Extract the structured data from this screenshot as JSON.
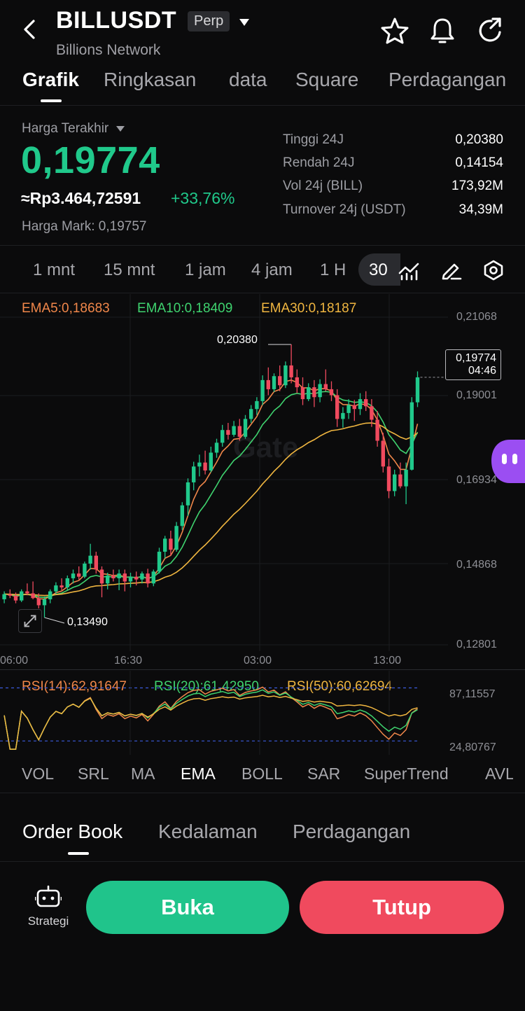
{
  "header": {
    "title": "BILLUSDT",
    "badge": "Perp",
    "subtitle": "Billions Network"
  },
  "tabs": [
    {
      "label": "Grafik",
      "active": true
    },
    {
      "label": "Ringkasan"
    },
    {
      "label": "data"
    },
    {
      "label": "Square"
    },
    {
      "label": "Perdagangan"
    }
  ],
  "price": {
    "last_label": "Harga Terakhir",
    "last": "0,19774",
    "idr": "≈Rp3.464,72591",
    "change": "+33,76%",
    "mark": "Harga Mark: 0,19757"
  },
  "stats": [
    {
      "label": "Tinggi 24J",
      "value": "0,20380"
    },
    {
      "label": "Rendah 24J",
      "value": "0,14154"
    },
    {
      "label": "Vol 24j (BILL)",
      "value": "173,92M"
    },
    {
      "label": "Turnover 24j (USDT)",
      "value": "34,39M"
    }
  ],
  "timeframes": [
    "1 mnt",
    "15 mnt",
    "1 jam",
    "4 jam",
    "1 H",
    "30"
  ],
  "active_timeframe": "30",
  "ema_labels": {
    "ema5": "EMA5:0,18683",
    "ema10": "EMA10:0,18409",
    "ema30": "EMA30:0,18187"
  },
  "chart_data": {
    "type": "candlestick",
    "y_ticks": [
      "0,21068",
      "0,19001",
      "0,16934",
      "0,14868",
      "0,12801"
    ],
    "x_ticks": [
      "06:00",
      "16:30",
      "03:00",
      "13:00"
    ],
    "high_label": "0,20380",
    "low_label": "0,13490",
    "last_price": "0,19774",
    "countdown": "04:46",
    "ylim": [
      0.12801,
      0.21068
    ],
    "candles": [
      [
        0.1395,
        0.1415,
        0.1385,
        0.1408
      ],
      [
        0.1408,
        0.142,
        0.1398,
        0.1404
      ],
      [
        0.1404,
        0.1412,
        0.1385,
        0.1392
      ],
      [
        0.1392,
        0.142,
        0.1388,
        0.1415
      ],
      [
        0.1415,
        0.1435,
        0.1405,
        0.141
      ],
      [
        0.141,
        0.144,
        0.1395,
        0.1398
      ],
      [
        0.1398,
        0.141,
        0.1372,
        0.138
      ],
      [
        0.138,
        0.1402,
        0.1349,
        0.1395
      ],
      [
        0.1395,
        0.142,
        0.1385,
        0.1415
      ],
      [
        0.1415,
        0.1438,
        0.1408,
        0.143
      ],
      [
        0.143,
        0.1448,
        0.1418,
        0.1425
      ],
      [
        0.1425,
        0.1455,
        0.1418,
        0.1448
      ],
      [
        0.1448,
        0.147,
        0.1435,
        0.146
      ],
      [
        0.146,
        0.1478,
        0.1445,
        0.1452
      ],
      [
        0.1452,
        0.149,
        0.1448,
        0.1485
      ],
      [
        0.1485,
        0.1535,
        0.147,
        0.1505
      ],
      [
        0.1505,
        0.1515,
        0.146,
        0.147
      ],
      [
        0.147,
        0.1478,
        0.14,
        0.1435
      ],
      [
        0.1435,
        0.1462,
        0.142,
        0.1455
      ],
      [
        0.1455,
        0.147,
        0.144,
        0.1448
      ],
      [
        0.1448,
        0.147,
        0.1418,
        0.146
      ],
      [
        0.146,
        0.147,
        0.1415,
        0.144
      ],
      [
        0.144,
        0.1462,
        0.1425,
        0.1452
      ],
      [
        0.1452,
        0.1465,
        0.143,
        0.1445
      ],
      [
        0.1445,
        0.1465,
        0.1435,
        0.146
      ],
      [
        0.146,
        0.1472,
        0.1425,
        0.1435
      ],
      [
        0.1435,
        0.147,
        0.1428,
        0.1465
      ],
      [
        0.1465,
        0.1525,
        0.146,
        0.1515
      ],
      [
        0.1515,
        0.1555,
        0.1498,
        0.1548
      ],
      [
        0.1548,
        0.1568,
        0.1505,
        0.152
      ],
      [
        0.152,
        0.159,
        0.1515,
        0.158
      ],
      [
        0.158,
        0.164,
        0.157,
        0.1632
      ],
      [
        0.1632,
        0.17,
        0.1605,
        0.169
      ],
      [
        0.169,
        0.1742,
        0.167,
        0.173
      ],
      [
        0.173,
        0.176,
        0.1705,
        0.174
      ],
      [
        0.174,
        0.177,
        0.171,
        0.172
      ],
      [
        0.172,
        0.178,
        0.1715,
        0.1765
      ],
      [
        0.1765,
        0.18,
        0.1752,
        0.179
      ],
      [
        0.179,
        0.1835,
        0.178,
        0.1822
      ],
      [
        0.1822,
        0.184,
        0.1798,
        0.181
      ],
      [
        0.181,
        0.1845,
        0.1805,
        0.1832
      ],
      [
        0.1832,
        0.185,
        0.1795,
        0.1805
      ],
      [
        0.1805,
        0.186,
        0.18,
        0.185
      ],
      [
        0.185,
        0.1885,
        0.184,
        0.1875
      ],
      [
        0.1875,
        0.1905,
        0.186,
        0.1895
      ],
      [
        0.1895,
        0.196,
        0.1885,
        0.1948
      ],
      [
        0.1948,
        0.198,
        0.191,
        0.1925
      ],
      [
        0.1925,
        0.1965,
        0.1918,
        0.1958
      ],
      [
        0.1958,
        0.1985,
        0.192,
        0.1935
      ],
      [
        0.1935,
        0.1995,
        0.1928,
        0.1985
      ],
      [
        0.1985,
        0.2038,
        0.194,
        0.1955
      ],
      [
        0.1955,
        0.1975,
        0.1915,
        0.193
      ],
      [
        0.193,
        0.1955,
        0.1885,
        0.19
      ],
      [
        0.19,
        0.194,
        0.1895,
        0.193
      ],
      [
        0.193,
        0.1948,
        0.188,
        0.1905
      ],
      [
        0.1905,
        0.195,
        0.1892,
        0.1938
      ],
      [
        0.1938,
        0.1975,
        0.192,
        0.1925
      ],
      [
        0.1925,
        0.1945,
        0.1895,
        0.191
      ],
      [
        0.191,
        0.1925,
        0.183,
        0.185
      ],
      [
        0.185,
        0.188,
        0.1828,
        0.1865
      ],
      [
        0.1865,
        0.19,
        0.185,
        0.1885
      ],
      [
        0.1885,
        0.1898,
        0.1845,
        0.1875
      ],
      [
        0.1875,
        0.1915,
        0.186,
        0.19
      ],
      [
        0.19,
        0.192,
        0.187,
        0.1882
      ],
      [
        0.1882,
        0.19,
        0.183,
        0.1848
      ],
      [
        0.1848,
        0.187,
        0.178,
        0.1795
      ],
      [
        0.1795,
        0.1815,
        0.1715,
        0.173
      ],
      [
        0.173,
        0.175,
        0.165,
        0.1668
      ],
      [
        0.1668,
        0.1722,
        0.1655,
        0.171
      ],
      [
        0.171,
        0.174,
        0.1675,
        0.168
      ],
      [
        0.168,
        0.174,
        0.1635,
        0.1722
      ],
      [
        0.1722,
        0.1905,
        0.172,
        0.1892
      ],
      [
        0.1892,
        0.197,
        0.188,
        0.1955
      ]
    ]
  },
  "rsi": {
    "rsi14": "RSI(14):62,91647",
    "rsi20": "RSI(20):61,42950",
    "rsi50": "RSI(50):60,62694",
    "top_value": "87,11557",
    "bottom_value": "24,80767",
    "ylim": [
      20,
      95
    ],
    "upper_band": 81.7,
    "lower_band": 30.0
  },
  "indicators": [
    "VOL",
    "SRL",
    "MA",
    "EMA",
    "BOLL",
    "SAR",
    "SuperTrend",
    "AVL"
  ],
  "active_indicator": "EMA",
  "orderbook_tabs": [
    "Order Book",
    "Kedalaman",
    "Perdagangan"
  ],
  "bottom": {
    "strategy_label": "Strategi",
    "buy_label": "Buka",
    "sell_label": "Tutup"
  },
  "colors": {
    "up": "#20c98b",
    "down": "#f04a5e",
    "ema5": "#f0874a",
    "ema10": "#3fd36f",
    "ema30": "#f0b640"
  }
}
